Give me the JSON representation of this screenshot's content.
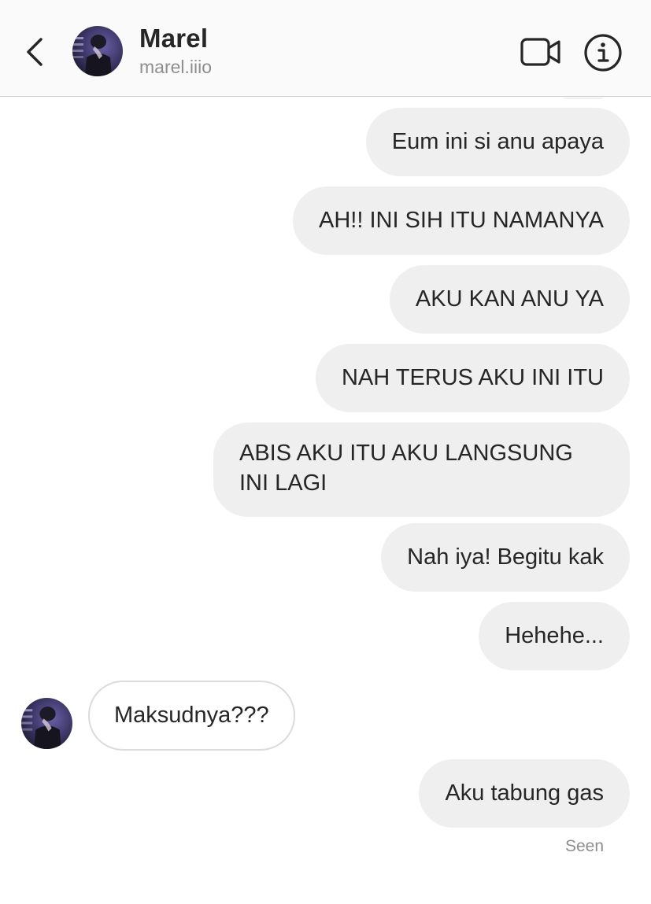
{
  "header": {
    "name": "Marel",
    "username": "marel.iiio",
    "back_icon": "chevron-left-icon",
    "video_icon": "video-camera-icon",
    "info_icon": "info-icon"
  },
  "messages": {
    "outgoing": [
      "Eum ini si anu apaya",
      "AH!! INI SIH ITU NAMANYA",
      "AKU KAN ANU YA",
      "NAH TERUS AKU INI ITU",
      "ABIS AKU ITU AKU LANGSUNG INI LAGI",
      "Nah iya! Begitu kak",
      "Hehehe..."
    ],
    "incoming": "Maksudnya???",
    "last": "Aku tabung gas"
  },
  "status": {
    "seen": "Seen"
  },
  "colors": {
    "outgoing_bubble": "#efefef",
    "incoming_bubble_border": "#dbdbdb",
    "secondary_text": "#8e8e8e",
    "header_bg": "#fafafa"
  }
}
